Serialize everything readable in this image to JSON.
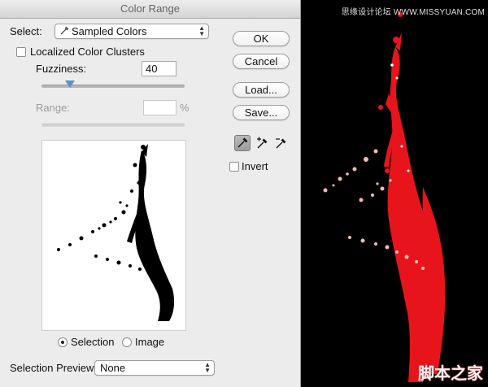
{
  "window": {
    "title": "Color Range"
  },
  "select": {
    "label": "Select:",
    "value": "Sampled Colors"
  },
  "localized": {
    "label": "Localized Color Clusters",
    "checked": false
  },
  "fuzziness": {
    "label": "Fuzziness:",
    "value": "40",
    "slider_fraction": 0.2
  },
  "range": {
    "label": "Range:",
    "value": "",
    "unit": "%"
  },
  "view": {
    "selection_label": "Selection",
    "image_label": "Image",
    "selected": "Selection"
  },
  "buttons": {
    "ok": "OK",
    "cancel": "Cancel",
    "load": "Load...",
    "save": "Save..."
  },
  "tools": [
    {
      "icon": "eyedropper-icon",
      "active": true
    },
    {
      "icon": "eyedropper-plus-icon",
      "active": false
    },
    {
      "icon": "eyedropper-minus-icon",
      "active": false
    }
  ],
  "invert": {
    "label": "Invert",
    "checked": false
  },
  "selection_preview": {
    "label": "Selection Preview:",
    "value": "None"
  },
  "watermarks": {
    "top": "思缘设计论坛 WWW.MISSYUAN.COM",
    "bottom": "脚本之家"
  },
  "colors": {
    "accent": "#5a90d6",
    "paint": "#e8141c"
  }
}
